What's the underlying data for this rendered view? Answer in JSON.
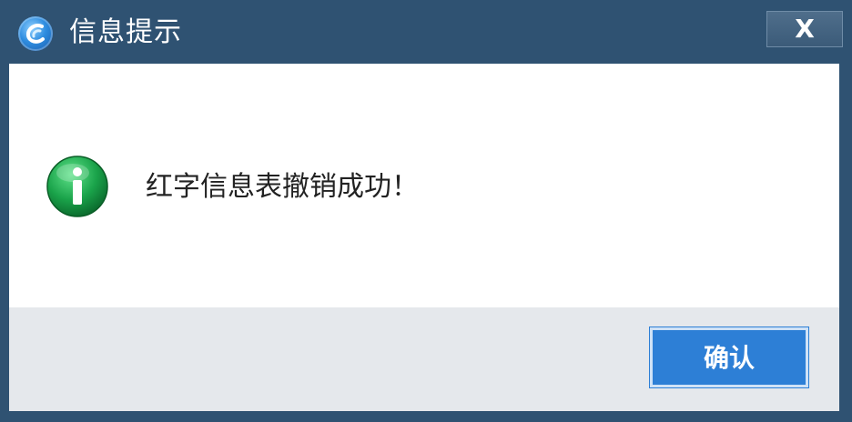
{
  "window": {
    "title": "信息提示",
    "close_label": "X"
  },
  "message": {
    "text": "红字信息表撤销成功！",
    "icon": "info-icon"
  },
  "footer": {
    "ok_label": "确认"
  },
  "colors": {
    "titlebar": "#2f5272",
    "button": "#2d7fd6",
    "info_icon": "#1aa34a",
    "footer": "#e5e8ec"
  }
}
